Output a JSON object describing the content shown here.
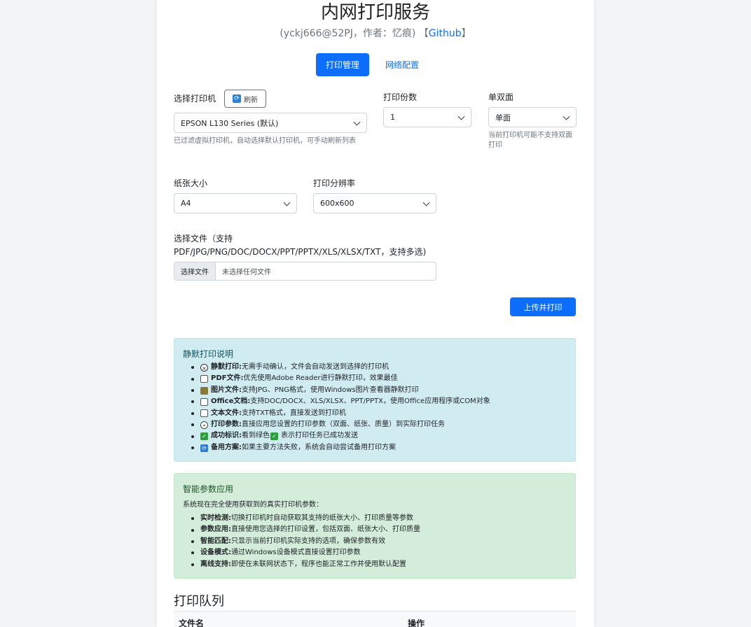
{
  "header": {
    "title": "内网打印服务",
    "subtitle_prefix": "(yckj666@52PJ，作者：忆痕) 【",
    "subtitle_link": "Github",
    "subtitle_suffix": "】"
  },
  "tabs": [
    {
      "label": "打印管理",
      "active": true
    },
    {
      "label": "网络配置",
      "active": false
    }
  ],
  "form": {
    "printer": {
      "label": "选择打印机",
      "refresh_label": "刷新",
      "value": "EPSON L130 Series (默认)",
      "hint": "已过滤虚拟打印机，自动选择默认打印机，可手动刷新列表"
    },
    "copies": {
      "label": "打印份数",
      "value": "1"
    },
    "duplex": {
      "label": "单双面",
      "value": "单面",
      "hint": "当前打印机可能不支持双面打印"
    },
    "paper": {
      "label": "纸张大小",
      "value": "A4"
    },
    "resolution": {
      "label": "打印分辨率",
      "value": "600x600"
    },
    "file": {
      "label_line1": "选择文件（支持",
      "label_line2": "PDF/JPG/PNG/DOC/DOCX/PPT/PPTX/XLS/XLSX/TXT，支持多选)",
      "button": "选择文件",
      "placeholder": "未选择任何文件"
    },
    "submit_label": "上传并打印"
  },
  "silent_info": {
    "title": "静默打印说明",
    "items": [
      {
        "icon": "mute-icon",
        "bold": "静默打印:",
        "text": " 无需手动确认，文件会自动发送到选择的打印机"
      },
      {
        "icon": "pdf-file-icon",
        "bold": "PDF文件:",
        "text": " 优先使用Adobe Reader进行静默打印，效果最佳"
      },
      {
        "icon": "image-file-icon",
        "bold": "图片文件:",
        "text": " 支持JPG、PNG格式，使用Windows图片查看器静默打印"
      },
      {
        "icon": "office-doc-icon",
        "bold": "Office文档:",
        "text": " 支持DOC/DOCX、XLS/XLSX、PPT/PPTX，使用Office应用程序或COM对象"
      },
      {
        "icon": "text-file-icon",
        "bold": "文本文件:",
        "text": " 支持TXT格式，直接发送到打印机"
      },
      {
        "icon": "settings-icon",
        "bold": "打印参数:",
        "text": " 直接应用您设置的打印参数（双面、纸张、质量）到实际打印任务"
      },
      {
        "icon": "check-icon",
        "bold": "成功标识:",
        "text": " 看到绿色",
        "text2": "表示打印任务已成功发送"
      },
      {
        "icon": "refresh-icon",
        "bold": "备用方案:",
        "text": " 如果主要方法失败，系统会自动尝试备用打印方案"
      }
    ]
  },
  "smart_params": {
    "title": "智能参数应用",
    "intro": "系统现在完全使用获取到的真实打印机参数：",
    "items": [
      {
        "bold": "实时检测:",
        "text": " 切换打印机时自动获取其支持的纸张大小、打印质量等参数"
      },
      {
        "bold": "参数应用:",
        "text": " 直接使用您选择的打印设置，包括双面、纸张大小、打印质量"
      },
      {
        "bold": "智能匹配:",
        "text": " 只显示当前打印机实际支持的选项，确保参数有效"
      },
      {
        "bold": "设备模式:",
        "text": " 通过Windows设备模式直接设置打印参数"
      },
      {
        "bold": "离线支持:",
        "text": " 即使在未联网状态下，程序也能正常工作并使用默认配置"
      }
    ]
  },
  "queue": {
    "title": "打印队列",
    "columns": [
      "文件名",
      "操作"
    ]
  },
  "colors": {
    "primary": "#0d6efd",
    "info_bg": "#d1ecf1",
    "success_bg": "#d4edda"
  }
}
